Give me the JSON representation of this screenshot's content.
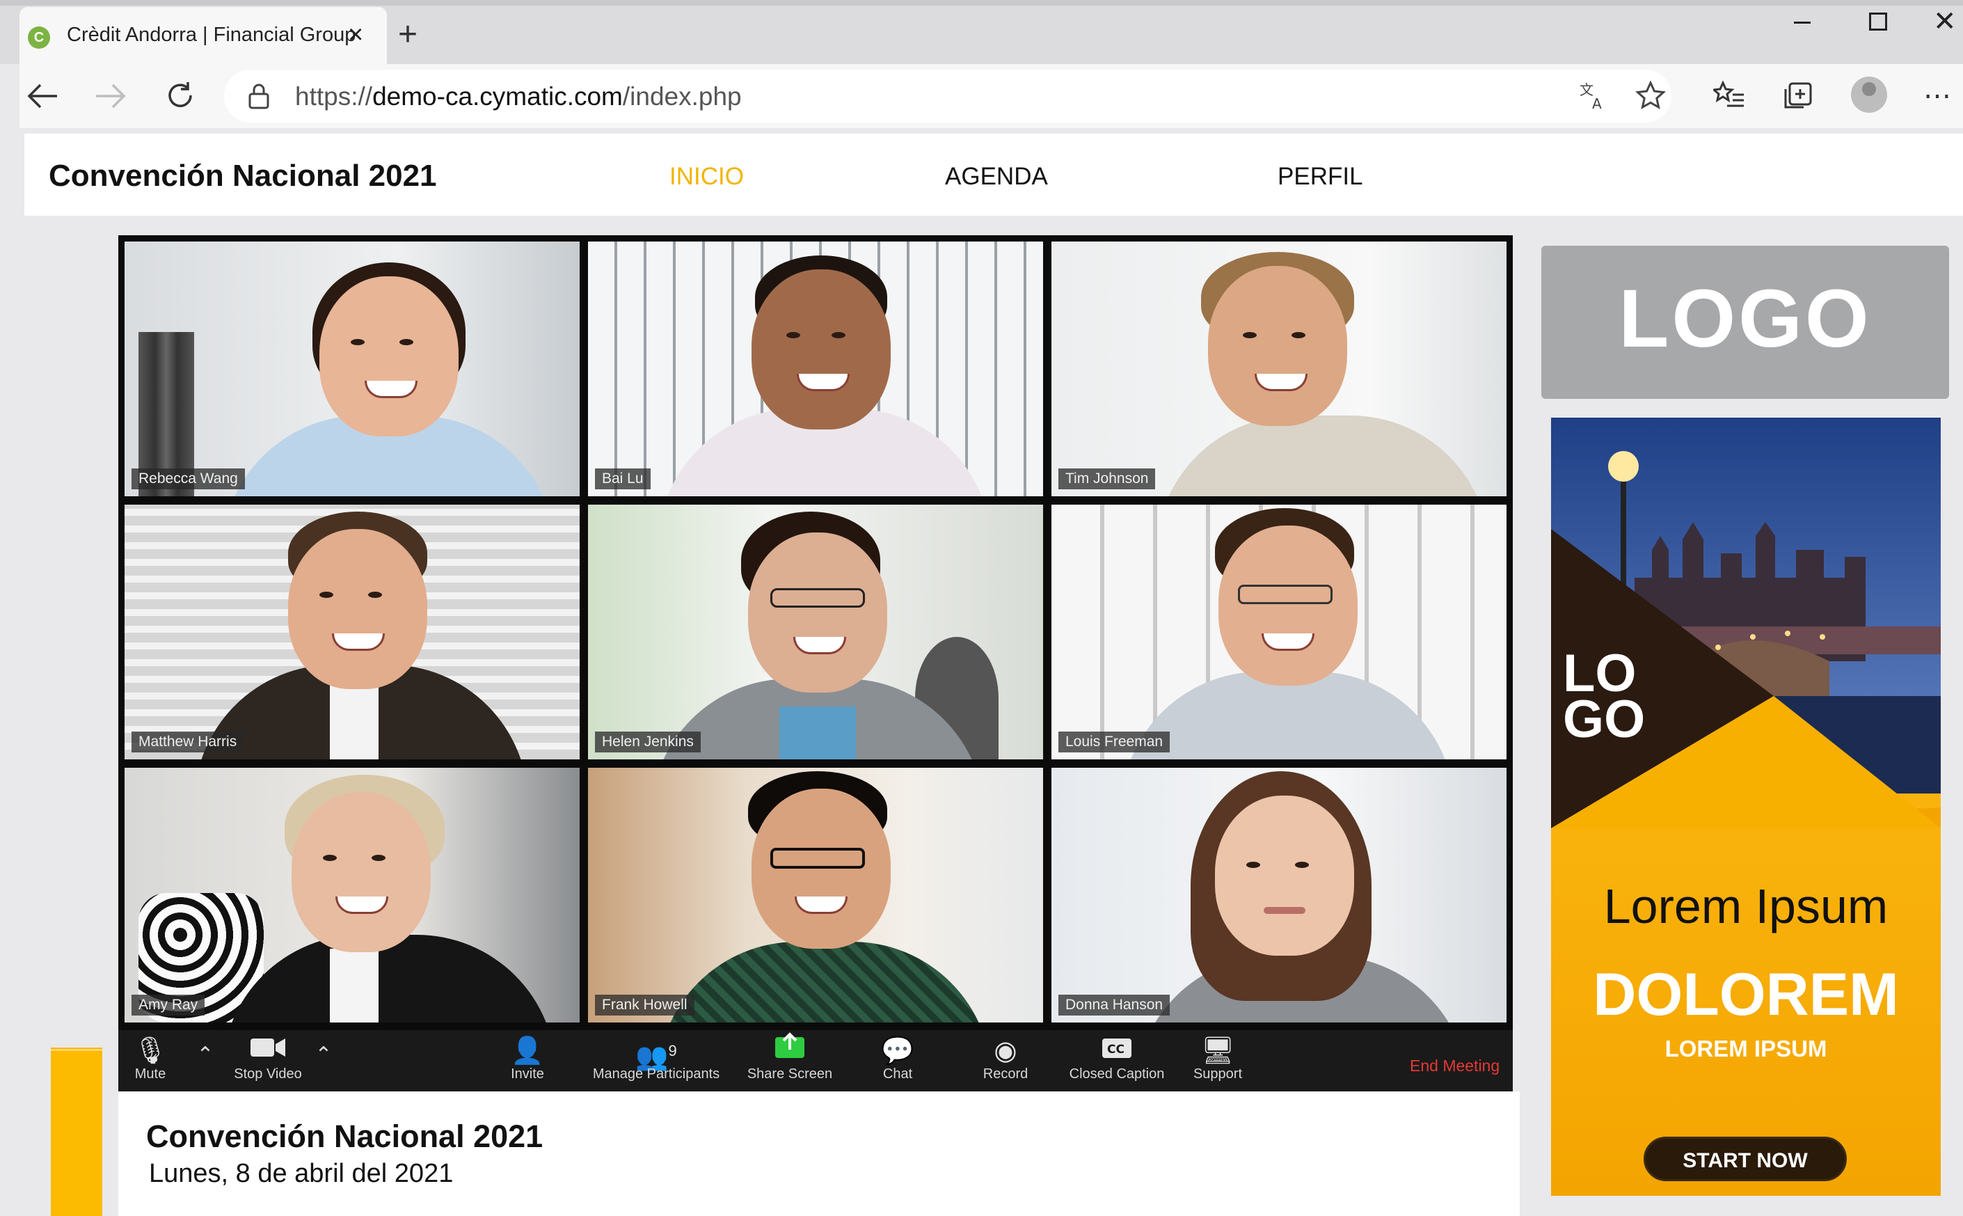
{
  "browser": {
    "tab_title": "Crèdit Andorra | Financial Group",
    "tab_close": "×",
    "new_tab": "+",
    "url_scheme": "https://",
    "url_host": "demo-ca.cymatic.com",
    "url_path": "/index.php",
    "icons": [
      "back-icon",
      "forward-icon",
      "refresh-icon",
      "lock-icon",
      "translate-icon",
      "star-icon",
      "favorites-icon",
      "collections-icon",
      "profile-icon",
      "more-icon"
    ]
  },
  "site": {
    "title": "Convención Nacional 2021",
    "nav": {
      "inicio": "INICIO",
      "agenda": "AGENDA",
      "perfil": "PERFIL"
    },
    "accent_color": "#f2b400"
  },
  "meeting": {
    "participants": [
      {
        "name": "Rebecca Wang"
      },
      {
        "name": "Bai Lu"
      },
      {
        "name": "Tim Johnson"
      },
      {
        "name": "Matthew Harris"
      },
      {
        "name": "Helen Jenkins"
      },
      {
        "name": "Louis Freeman"
      },
      {
        "name": "Amy Ray"
      },
      {
        "name": "Frank Howell"
      },
      {
        "name": "Donna Hanson"
      }
    ],
    "controls": {
      "mute": "Mute",
      "stop_video": "Stop Video",
      "invite": "Invite",
      "manage_participants": "Manage Participants",
      "participant_count": "9",
      "share_screen": "Share Screen",
      "chat": "Chat",
      "record": "Record",
      "closed_caption": "Closed Caption",
      "support": "Support",
      "end_meeting": "End Meeting"
    }
  },
  "event": {
    "title": "Convención Nacional 2021",
    "date": "Lunes, 8 de abril del 2021"
  },
  "sidebar": {
    "logo": "LOGO",
    "ad": {
      "logo": "LO\nGO",
      "title": "Lorem Ipsum",
      "headline": "DOLOREM",
      "subheadline": "LOREM IPSUM",
      "button": "START NOW"
    }
  }
}
